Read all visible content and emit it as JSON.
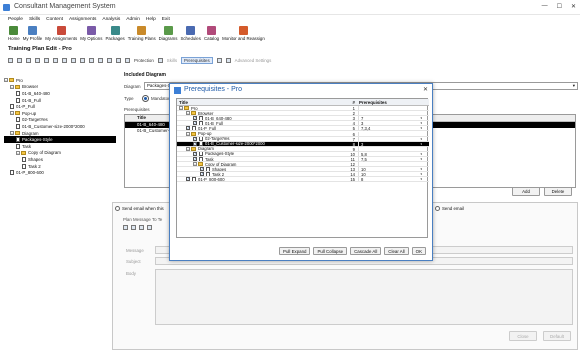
{
  "window": {
    "title": "Consultant Management System",
    "controls": [
      "—",
      "☐",
      "✕"
    ]
  },
  "menu": [
    "People",
    "Skills",
    "Content",
    "Assignments",
    "Analysis",
    "Admin",
    "Help",
    "Exit"
  ],
  "toolbar": [
    {
      "label": "Home",
      "color": "#4a8a3a"
    },
    {
      "label": "My Profile",
      "color": "#4a7fc1"
    },
    {
      "label": "My Assignments",
      "color": "#c94a3a"
    },
    {
      "label": "My Options",
      "color": "#7a5aa8"
    },
    {
      "label": "Packages",
      "color": "#3a8a8a"
    },
    {
      "label": "Training Plans",
      "color": "#c98a2a"
    },
    {
      "label": "Diagrams",
      "color": "#5a9a4a"
    },
    {
      "label": "Schedules",
      "color": "#4a6ab1"
    },
    {
      "label": "Catalog",
      "color": "#b14a7a"
    },
    {
      "label": "Monitor and Reassign",
      "color": "#d45a2a"
    }
  ],
  "page_title": "Training Plan Edit - Pro",
  "subtoolbar": {
    "protection": "Protection",
    "skills": "Skills",
    "prerequisites": "Prerequisites",
    "advanced": "Advanced Settings"
  },
  "left_tree": [
    {
      "label": "Pro",
      "level": 0,
      "kind": "folder"
    },
    {
      "label": "Browser",
      "level": 1,
      "kind": "folder"
    },
    {
      "label": "01-B_640-480",
      "level": 2,
      "kind": "doc"
    },
    {
      "label": "01-B_Full",
      "level": 2,
      "kind": "doc"
    },
    {
      "label": "01-P_Full",
      "level": 1,
      "kind": "doc"
    },
    {
      "label": "Pop-up",
      "level": 1,
      "kind": "folder"
    },
    {
      "label": "02-TargetYes",
      "level": 2,
      "kind": "doc"
    },
    {
      "label": "01-B_Customer-size-2000*2000",
      "level": 2,
      "kind": "doc"
    },
    {
      "label": "Diagram",
      "level": 1,
      "kind": "folder"
    },
    {
      "label": "Packages-Style",
      "level": 2,
      "kind": "doc",
      "selected": true
    },
    {
      "label": "Task",
      "level": 2,
      "kind": "doc"
    },
    {
      "label": "Copy of Diagram",
      "level": 2,
      "kind": "folder"
    },
    {
      "label": "Shapes",
      "level": 3,
      "kind": "doc"
    },
    {
      "label": "Task 2",
      "level": 3,
      "kind": "doc"
    },
    {
      "label": "01-P_800-600",
      "level": 1,
      "kind": "doc"
    }
  ],
  "included_diagram": {
    "header": "Included Diagram",
    "diagram_label": "Diagram",
    "diagram_value": "Packages-Style",
    "type_label": "Type",
    "type_value": "Mandatory",
    "prereq_label": "Prerequisites",
    "table_header": "Title",
    "rows": [
      "01-B_640-480",
      "01-B_Customer-size"
    ]
  },
  "buttons": {
    "add": "Add",
    "delete": "Delete",
    "close": "Close",
    "default": "Default"
  },
  "message_panel": {
    "send_email": "Send email when this",
    "send_email_right": "Send email",
    "plan_message": "Plan Message To Te",
    "message_label": "Message",
    "subject_label": "Subject",
    "body_label": "Body"
  },
  "dialog": {
    "title": "Prerequisites - Pro",
    "close": "✕",
    "columns": {
      "title": "Title",
      "num": "#",
      "prereq": "Prerequisites"
    },
    "rows": [
      {
        "title": "Pro",
        "num": "1",
        "prereq": "",
        "level": 0,
        "kind": "folder",
        "check": false
      },
      {
        "title": "Browser",
        "num": "2",
        "prereq": "",
        "level": 1,
        "kind": "folder",
        "check": false
      },
      {
        "title": "01-B_640-480",
        "num": "3",
        "prereq": "7",
        "level": 2,
        "kind": "doc",
        "check": true
      },
      {
        "title": "01-B_Full",
        "num": "4",
        "prereq": "3",
        "level": 2,
        "kind": "doc",
        "check": true
      },
      {
        "title": "01-P_Full",
        "num": "5",
        "prereq": "7,3,4",
        "level": 1,
        "kind": "doc",
        "check": true
      },
      {
        "title": "Pop-up",
        "num": "6",
        "prereq": "",
        "level": 1,
        "kind": "folder",
        "check": false
      },
      {
        "title": "02-TargetYes",
        "num": "7",
        "prereq": "",
        "level": 2,
        "kind": "doc",
        "check": true
      },
      {
        "title": "01-B_Customer-size-2000*2000",
        "num": "8",
        "prereq": "3",
        "level": 2,
        "kind": "doc",
        "check": true,
        "selected": true
      },
      {
        "title": "Diagram",
        "num": "9",
        "prereq": "",
        "level": 1,
        "kind": "folder",
        "check": false
      },
      {
        "title": "Packages-Style",
        "num": "10",
        "prereq": "5,8",
        "level": 2,
        "kind": "doc",
        "check": true
      },
      {
        "title": "Task",
        "num": "11",
        "prereq": "7,5",
        "level": 2,
        "kind": "doc",
        "check": true
      },
      {
        "title": "Copy of Diagram",
        "num": "12",
        "prereq": "",
        "level": 2,
        "kind": "folder",
        "check": false
      },
      {
        "title": "Shapes",
        "num": "13",
        "prereq": "10",
        "level": 3,
        "kind": "doc",
        "check": true
      },
      {
        "title": "Task 2",
        "num": "14",
        "prereq": "10",
        "level": 3,
        "kind": "doc",
        "check": true
      },
      {
        "title": "01-P_800-600",
        "num": "15",
        "prereq": "8",
        "level": 1,
        "kind": "doc",
        "check": true
      }
    ],
    "buttons": [
      "Pull Expand",
      "Pull Collapse",
      "Cascade All",
      "Clear All",
      "OK"
    ]
  }
}
